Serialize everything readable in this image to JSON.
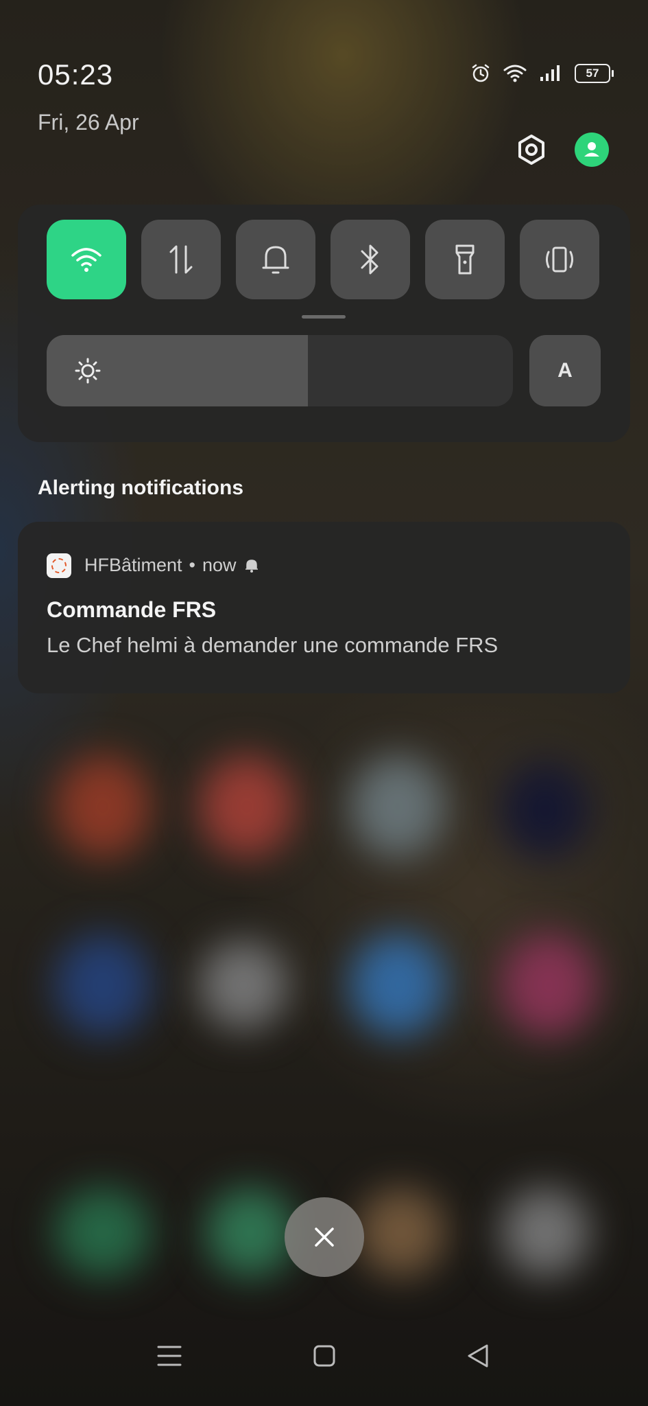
{
  "status_bar": {
    "time": "05:23",
    "date": "Fri, 26 Apr",
    "battery": "57",
    "icons": [
      "alarm-icon",
      "wifi-icon",
      "cellular-signal-icon",
      "battery-icon"
    ]
  },
  "header": {
    "settings_icon": "settings-gear-icon",
    "user_icon": "user-avatar-icon"
  },
  "quick_settings": {
    "tiles": [
      {
        "name": "wifi",
        "icon": "wifi-icon",
        "active": true
      },
      {
        "name": "mobile-data",
        "icon": "data-arrows-icon",
        "active": false
      },
      {
        "name": "sound",
        "icon": "bell-icon",
        "active": false
      },
      {
        "name": "bluetooth",
        "icon": "bluetooth-icon",
        "active": false
      },
      {
        "name": "flashlight",
        "icon": "flashlight-icon",
        "active": false
      },
      {
        "name": "vibrate",
        "icon": "vibrate-icon",
        "active": false
      }
    ],
    "brightness_level": 0.56,
    "auto_brightness_label": "A"
  },
  "notifications": {
    "section_title": "Alerting notifications",
    "items": [
      {
        "app_name": "HFBâtiment",
        "separator": "•",
        "time": "now",
        "title": "Commande FRS",
        "body": "Le Chef helmi à demander une commande FRS"
      }
    ]
  },
  "colors": {
    "accent": "#2ed486",
    "panel": "#262626",
    "tile": "#4d4d4d"
  },
  "nav": {
    "close_icon": "close-icon",
    "buttons": [
      "menu-icon",
      "home-icon",
      "back-icon"
    ]
  }
}
